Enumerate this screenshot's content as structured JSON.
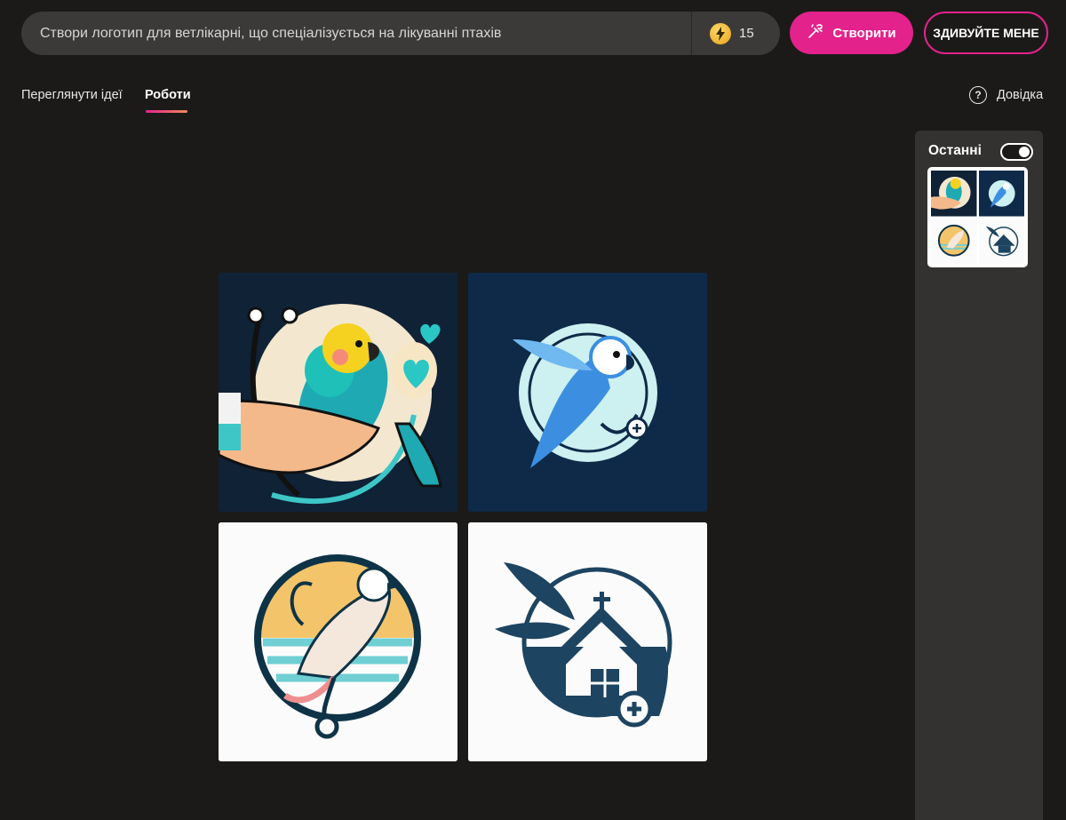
{
  "prompt": {
    "text": "Створи логотип для ветлікарні, що спеціалізується на лікуванні птахів",
    "boost_count": "15",
    "boost_icon": "lightning-bolt-icon"
  },
  "actions": {
    "create_label": "Створити",
    "surprise_label": "ЗДИВУЙТЕ МЕНЕ"
  },
  "tabs": [
    {
      "label": "Переглянути ідеї",
      "active": false
    },
    {
      "label": "Роботи",
      "active": true
    }
  ],
  "help": {
    "label": "Довідка",
    "icon": "?"
  },
  "sidebar": {
    "title": "Останні",
    "toggle_on": true
  },
  "colors": {
    "accent": "#e3228b",
    "background": "#1b1a19",
    "prompt_bg": "#3b3a39",
    "sidebar_bg": "#333231"
  }
}
